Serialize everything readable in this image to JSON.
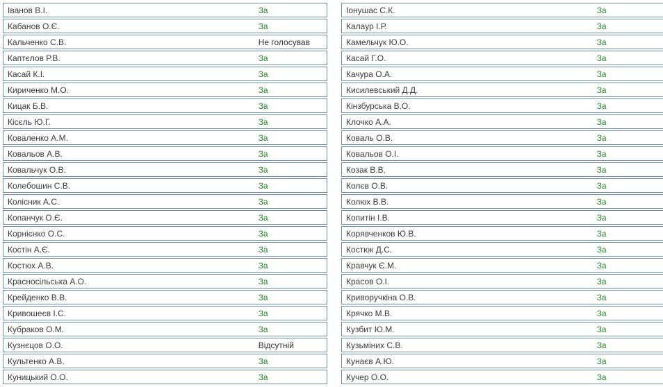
{
  "vote_classes": {
    "За": "za",
    "Не голосував": "ng",
    "Відсутній": "ab"
  },
  "left": [
    {
      "name": "Іванов В.І.",
      "vote": "За"
    },
    {
      "name": "Кабанов О.Є.",
      "vote": "За"
    },
    {
      "name": "Кальченко С.В.",
      "vote": "Не голосував"
    },
    {
      "name": "Каптєлов Р.В.",
      "vote": "За"
    },
    {
      "name": "Касай К.І.",
      "vote": "За"
    },
    {
      "name": "Кириченко М.О.",
      "vote": "За"
    },
    {
      "name": "Кицак Б.В.",
      "vote": "За"
    },
    {
      "name": "Кісєль Ю.Г.",
      "vote": "За"
    },
    {
      "name": "Коваленко А.М.",
      "vote": "За"
    },
    {
      "name": "Ковальов А.В.",
      "vote": "За"
    },
    {
      "name": "Ковальчук О.В.",
      "vote": "За"
    },
    {
      "name": "Колебошин С.В.",
      "vote": "За"
    },
    {
      "name": "Колісник А.С.",
      "vote": "За"
    },
    {
      "name": "Копанчук О.Є.",
      "vote": "За"
    },
    {
      "name": "Корнієнко О.С.",
      "vote": "За"
    },
    {
      "name": "Костін А.Є.",
      "vote": "За"
    },
    {
      "name": "Костюх А.В.",
      "vote": "За"
    },
    {
      "name": "Красносільська А.О.",
      "vote": "За"
    },
    {
      "name": "Крейденко В.В.",
      "vote": "За"
    },
    {
      "name": "Кривошеєв І.С.",
      "vote": "За"
    },
    {
      "name": "Кубраков О.М.",
      "vote": "За"
    },
    {
      "name": "Кузнєцов О.О.",
      "vote": "Відсутній"
    },
    {
      "name": "Культенко А.В.",
      "vote": "За"
    },
    {
      "name": "Куницький О.О.",
      "vote": "За"
    }
  ],
  "right": [
    {
      "name": "Іонушас С.К.",
      "vote": "За"
    },
    {
      "name": "Калаур І.Р.",
      "vote": "За"
    },
    {
      "name": "Камельчук Ю.О.",
      "vote": "За"
    },
    {
      "name": "Касай Г.О.",
      "vote": "За"
    },
    {
      "name": "Качура О.А.",
      "vote": "За"
    },
    {
      "name": "Кисилевський Д.Д.",
      "vote": "За"
    },
    {
      "name": "Кінзбурська В.О.",
      "vote": "За"
    },
    {
      "name": "Клочко А.А.",
      "vote": "За"
    },
    {
      "name": "Коваль О.В.",
      "vote": "За"
    },
    {
      "name": "Ковальов О.І.",
      "vote": "За"
    },
    {
      "name": "Козак В.В.",
      "vote": "За"
    },
    {
      "name": "Колєв О.В.",
      "vote": "За"
    },
    {
      "name": "Колюх В.В.",
      "vote": "За"
    },
    {
      "name": "Копитін І.В.",
      "vote": "За"
    },
    {
      "name": "Корявченков Ю.В.",
      "vote": "За"
    },
    {
      "name": "Костюк Д.С.",
      "vote": "За"
    },
    {
      "name": "Кравчук Є.М.",
      "vote": "За"
    },
    {
      "name": "Красов О.І.",
      "vote": "За"
    },
    {
      "name": "Криворучкіна О.В.",
      "vote": "За"
    },
    {
      "name": "Крячко М.В.",
      "vote": "За"
    },
    {
      "name": "Кузбит Ю.М.",
      "vote": "За"
    },
    {
      "name": "Кузьміних С.В.",
      "vote": "За"
    },
    {
      "name": "Кунаєв А.Ю.",
      "vote": "За"
    },
    {
      "name": "Кучер О.О.",
      "vote": "За"
    }
  ]
}
